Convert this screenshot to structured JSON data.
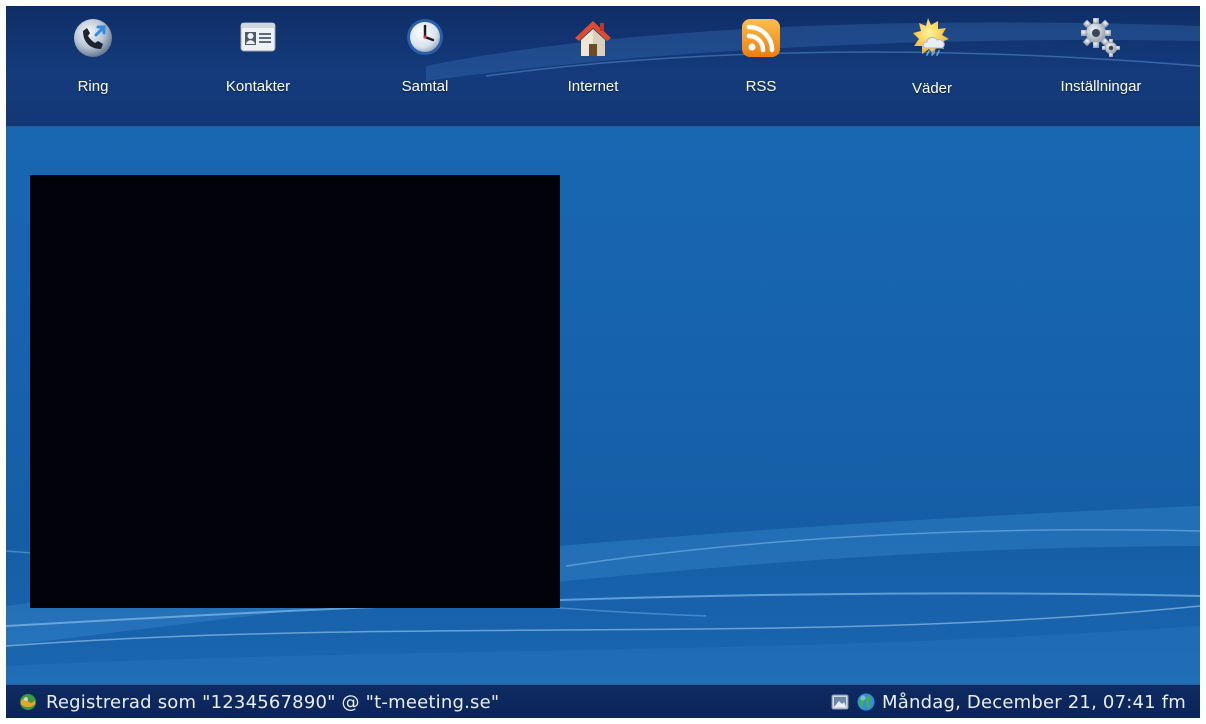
{
  "nav": {
    "items": [
      {
        "id": "ring",
        "label": "Ring",
        "icon": "phone-call-icon"
      },
      {
        "id": "kontakter",
        "label": "Kontakter",
        "icon": "contact-card-icon"
      },
      {
        "id": "samtal",
        "label": "Samtal",
        "icon": "clock-icon"
      },
      {
        "id": "internet",
        "label": "Internet",
        "icon": "home-icon"
      },
      {
        "id": "rss",
        "label": "RSS",
        "icon": "rss-icon"
      },
      {
        "id": "vader",
        "label": "Väder",
        "icon": "weather-icon"
      },
      {
        "id": "installningar",
        "label": "Inställningar",
        "icon": "gears-icon"
      }
    ]
  },
  "status": {
    "registration": "Registrerad som \"1234567890\" @ \"t-meeting.se\"",
    "datetime": "Måndag, December 21, 07:41 fm"
  },
  "colors": {
    "background": "#1763ad",
    "topbar": "#133a7a",
    "statusbar": "#0c2759",
    "video_preview": "#02030a",
    "rss_orange": "#f39a1c",
    "home_red": "#d9442c"
  }
}
